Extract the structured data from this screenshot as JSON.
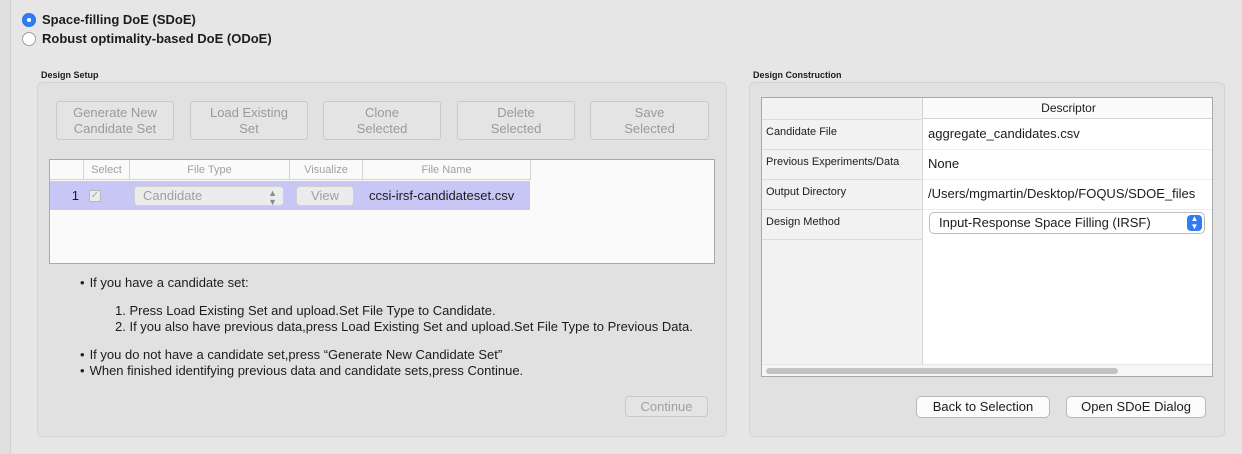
{
  "doe_options": [
    {
      "label": "Space-filling DoE (SDoE)",
      "selected": true
    },
    {
      "label": "Robust optimality-based DoE (ODoE)",
      "selected": false
    }
  ],
  "design_setup": {
    "title": "Design Setup",
    "toolbar": [
      "Generate New\nCandidate Set",
      "Load Existing\nSet",
      "Clone\nSelected",
      "Delete\nSelected",
      "Save\nSelected"
    ],
    "table": {
      "columns": [
        "Select",
        "File Type",
        "Visualize",
        "File Name"
      ],
      "rows": [
        {
          "num": "1",
          "checked": true,
          "file_type": "Candidate",
          "visualize": "View",
          "file_name": "ccsi-irsf-candidateset.csv"
        }
      ]
    },
    "instructions": {
      "b1": "If you have a candidate set:",
      "s1": "1. Press Load Existing Set and upload.Set File Type to Candidate.",
      "s2": "2. If you also have previous data,press Load Existing Set and upload.Set File Type to Previous Data.",
      "b2": "If you do not have a candidate set,press “Generate New Candidate Set”",
      "b3": "When finished identifying previous data and candidate sets,press Continue."
    },
    "continue_label": "Continue"
  },
  "design_construction": {
    "title": "Design Construction",
    "column_header": "Descriptor",
    "rows": [
      {
        "label": "Candidate File",
        "value": "aggregate_candidates.csv"
      },
      {
        "label": "Previous Experiments/Data",
        "value": "None"
      },
      {
        "label": "Output Directory",
        "value": "/Users/mgmartin/Desktop/FOQUS/SDOE_files"
      },
      {
        "label": "Design Method",
        "value": "Input-Response Space Filling (IRSF)"
      }
    ],
    "back_label": "Back to Selection",
    "open_label": "Open SDoE Dialog"
  },
  "colors": {
    "accent": "#2f7cf6",
    "row_highlight": "#c8c6f5"
  }
}
